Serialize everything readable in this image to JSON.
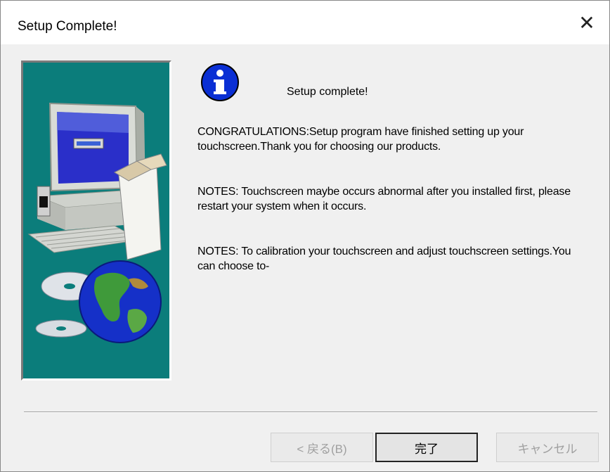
{
  "window": {
    "title": "Setup Complete!",
    "close_glyph": "✕"
  },
  "content": {
    "icon": "info-icon",
    "headline": "Setup complete!",
    "paragraphs": [
      "CONGRATULATIONS:Setup program have finished setting up your touchscreen.Thank you for choosing our products.",
      "NOTES: Touchscreen maybe occurs abnormal after you installed first, please restart your system when it occurs.",
      "NOTES: To calibration your touchscreen and adjust touchscreen settings.You can choose to-"
    ]
  },
  "side_image": {
    "icon": "computer-cd-globe-illustration",
    "background_color": "#0b7d7b"
  },
  "buttons": {
    "back_label": "< 戻る(B)",
    "finish_label": "完了",
    "cancel_label": "キャンセル"
  }
}
